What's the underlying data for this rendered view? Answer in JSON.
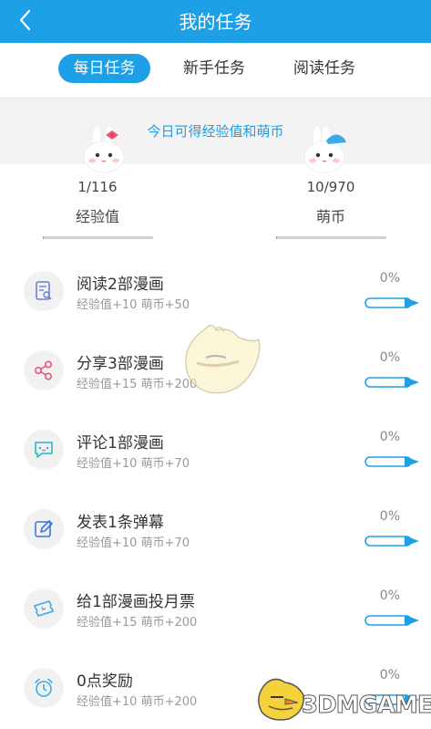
{
  "header": {
    "title": "我的任务"
  },
  "tabs": [
    {
      "label": "每日任务",
      "active": true
    },
    {
      "label": "新手任务",
      "active": false
    },
    {
      "label": "阅读任务",
      "active": false
    }
  ],
  "summary": {
    "text": "今日可得经验值和萌币",
    "exp": {
      "value": "1/116",
      "label": "经验值",
      "progress": 0.01
    },
    "coins": {
      "value": "10/970",
      "label": "萌币",
      "progress": 0.01
    }
  },
  "tasks": [
    {
      "name": "阅读2部漫画",
      "reward": "经验值+10 萌币+50",
      "percent": "0%",
      "icon": "read-icon",
      "color": "#6f7fd9"
    },
    {
      "name": "分享3部漫画",
      "reward": "经验值+15 萌币+200",
      "percent": "0%",
      "icon": "share-icon",
      "color": "#f0537a"
    },
    {
      "name": "评论1部漫画",
      "reward": "经验值+10 萌币+70",
      "percent": "0%",
      "icon": "comment-icon",
      "color": "#27b6c9"
    },
    {
      "name": "发表1条弹幕",
      "reward": "经验值+10 萌币+70",
      "percent": "0%",
      "icon": "edit-icon",
      "color": "#3a78e0"
    },
    {
      "name": "给1部漫画投月票",
      "reward": "经验值+15 萌币+200",
      "percent": "0%",
      "icon": "ticket-icon",
      "color": "#3fa9e8"
    },
    {
      "name": "0点奖励",
      "reward": "经验值+10 萌币+200",
      "percent": "0%",
      "icon": "alarm-clock-icon",
      "color": "#3fa9e8"
    }
  ],
  "watermark": {
    "text": "3DMGAME"
  },
  "colors": {
    "accent": "#1ea0e6"
  }
}
